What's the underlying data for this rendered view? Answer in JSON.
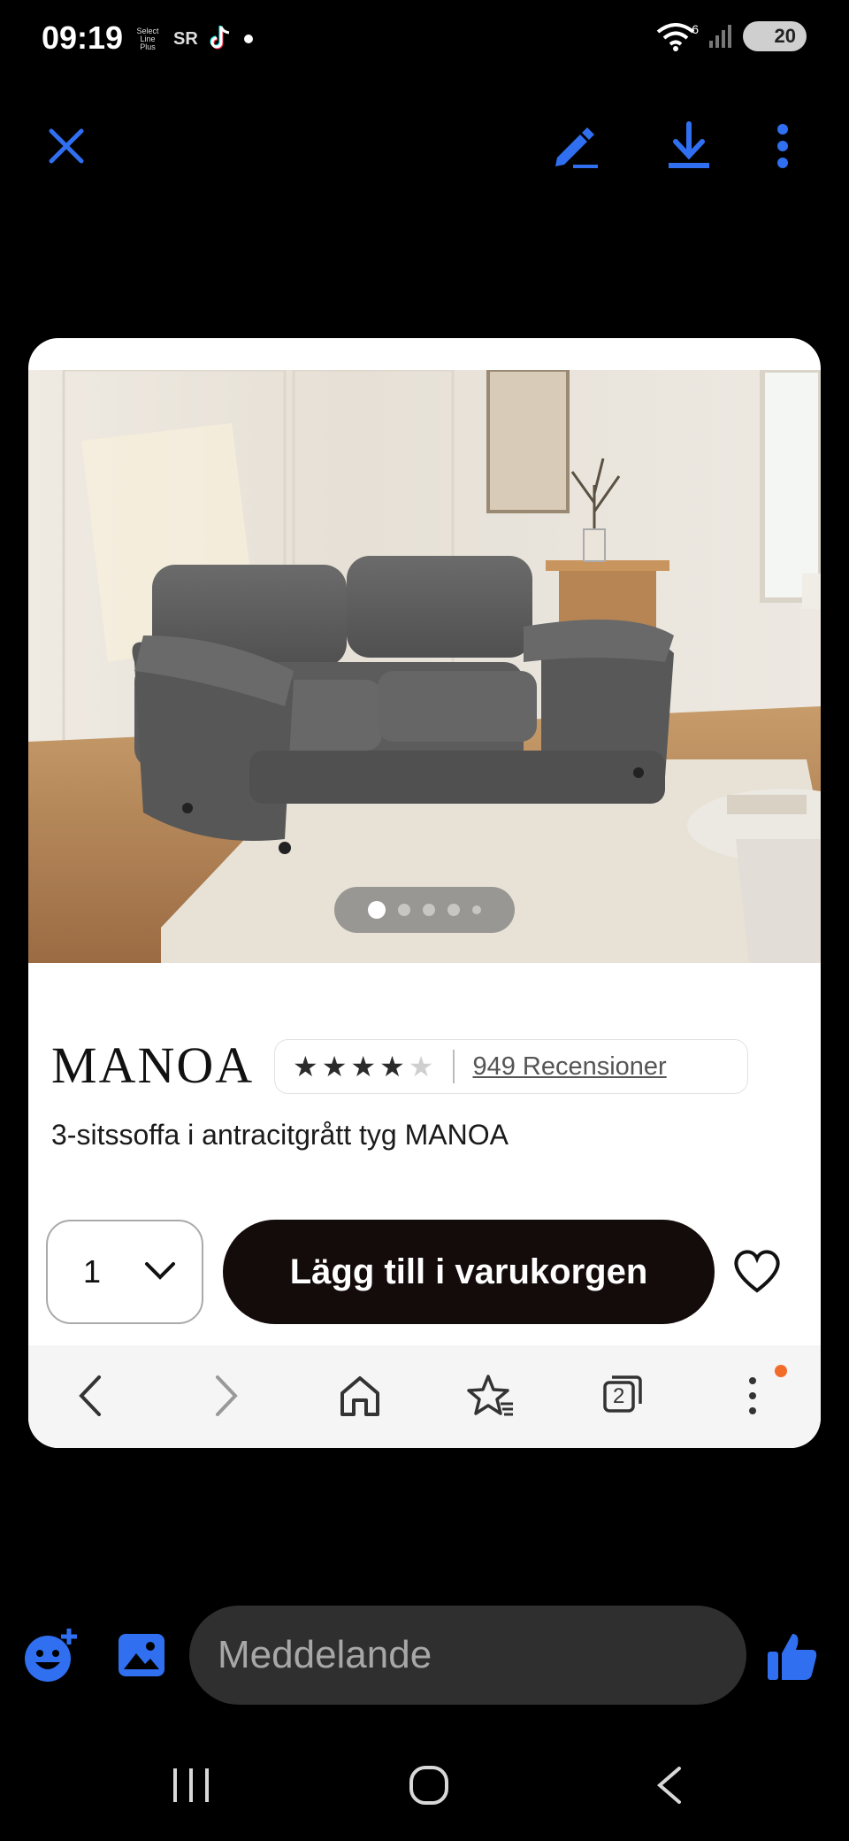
{
  "status_bar": {
    "time": "09:19",
    "badge_1": "Select Line Plus",
    "badge_2": "SR",
    "signal_badge": "6",
    "battery": "20"
  },
  "toolbar": {
    "icons": [
      "close-icon",
      "edit-icon",
      "download-icon",
      "more-icon"
    ],
    "accent_color": "#2f6ff0"
  },
  "product": {
    "image_dots": 5,
    "active_dot": 1,
    "brand": "MANOA",
    "rating": 4,
    "rating_max": 5,
    "reviews": "949 Recensioner",
    "title": "3-sitssoffa i antracitgrått tyg MANOA",
    "quantity": "1",
    "add_to_cart": "Lägg till i varukorgen"
  },
  "browser_nav": {
    "tabs_count": "2",
    "icons": [
      "back-icon",
      "forward-icon",
      "home-icon",
      "bookmarks-icon",
      "tabs-icon",
      "menu-icon"
    ]
  },
  "composer": {
    "placeholder": "Meddelande",
    "icons": [
      "emoji-add-icon",
      "gallery-icon",
      "thumbs-up-icon"
    ]
  },
  "system_nav": {
    "icons": [
      "recents-icon",
      "home-icon",
      "back-icon"
    ]
  }
}
